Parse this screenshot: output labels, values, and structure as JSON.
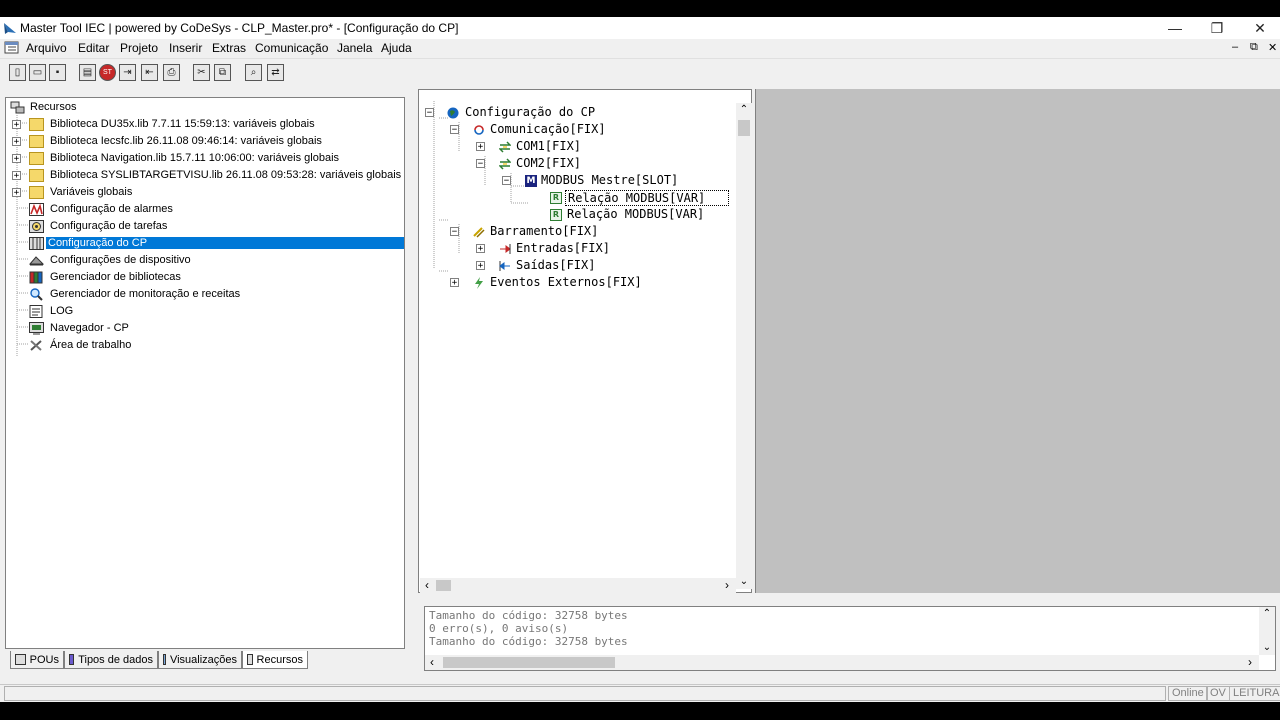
{
  "window": {
    "title": "Master Tool IEC | powered by CoDeSys - CLP_Master.pro* - [Configuração do CP]",
    "minimize_glyph": "—",
    "restore_glyph": "❐",
    "close_glyph": "✕",
    "child_minimize_glyph": "–",
    "child_restore_glyph": "⧉",
    "child_close_glyph": "✕"
  },
  "menu": [
    "Arquivo",
    "Editar",
    "Projeto",
    "Inserir",
    "Extras",
    "Comunicação",
    "Janela",
    "Ajuda"
  ],
  "toolbar": {
    "icons": [
      "new-icon",
      "open-icon",
      "save-icon",
      "build-icon",
      "stop-icon",
      "login-icon",
      "logout-icon",
      "print-icon",
      "cut-icon",
      "copy-icon",
      "find-icon",
      "replace-icon"
    ],
    "glyphs": [
      "▯",
      "▭",
      "▪",
      "▤",
      "ST",
      "⇥",
      "⇤",
      "⎙",
      "✂",
      "⧉",
      "⌕",
      "⇄"
    ]
  },
  "resources_tree": {
    "root": "Recursos",
    "items": [
      {
        "label": "Biblioteca DU35x.lib 7.7.11 15:59:13: variáveis globais",
        "expander": "+",
        "icon": "folder-icon"
      },
      {
        "label": "Biblioteca Iecsfc.lib 26.11.08 09:46:14: variáveis globais",
        "expander": "+",
        "icon": "folder-icon"
      },
      {
        "label": "Biblioteca Navigation.lib 15.7.11 10:06:00: variáveis globais",
        "expander": "+",
        "icon": "folder-icon"
      },
      {
        "label": "Biblioteca SYSLIBTARGETVISU.lib 26.11.08 09:53:28: variáveis globais",
        "expander": "+",
        "icon": "folder-icon"
      },
      {
        "label": "Variáveis globais",
        "expander": "+",
        "icon": "folder-icon"
      },
      {
        "label": "Configuração de alarmes",
        "expander": "",
        "icon": "alarm-icon"
      },
      {
        "label": "Configuração de tarefas",
        "expander": "",
        "icon": "task-icon"
      },
      {
        "label": "Configuração do CP",
        "expander": "",
        "icon": "plc-config-icon",
        "selected": true
      },
      {
        "label": "Configurações de dispositivo",
        "expander": "",
        "icon": "device-icon"
      },
      {
        "label": "Gerenciador de bibliotecas",
        "expander": "",
        "icon": "library-icon"
      },
      {
        "label": "Gerenciador de monitoração e receitas",
        "expander": "",
        "icon": "magnifier-icon"
      },
      {
        "label": "LOG",
        "expander": "",
        "icon": "log-icon"
      },
      {
        "label": "Navegador - CP",
        "expander": "",
        "icon": "navigator-icon"
      },
      {
        "label": "Área de trabalho",
        "expander": "",
        "icon": "tools-icon"
      }
    ]
  },
  "bottom_tabs": [
    {
      "label": "POUs",
      "active": false
    },
    {
      "label": "Tipos de dados",
      "active": false
    },
    {
      "label": "Visualizações",
      "active": false
    },
    {
      "label": "Recursos",
      "active": true
    }
  ],
  "config_tree": [
    {
      "label": "Configuração do CP",
      "expander": "−",
      "icon": "globe-icon"
    },
    {
      "label": "Comunicação[FIX]",
      "expander": "−",
      "icon": "communication-icon"
    },
    {
      "label": "COM1[FIX]",
      "expander": "+",
      "icon": "serial-port-icon"
    },
    {
      "label": "COM2[FIX]",
      "expander": "−",
      "icon": "serial-port-icon"
    },
    {
      "label": "MODBUS Mestre[SLOT]",
      "expander": "−",
      "icon": "modbus-master-icon",
      "glyph": "M"
    },
    {
      "label": "Relação MODBUS[VAR]",
      "expander": "",
      "icon": "modbus-relation-icon",
      "glyph": "R",
      "focused": true
    },
    {
      "label": "Relação MODBUS[VAR]",
      "expander": "",
      "icon": "modbus-relation-icon",
      "glyph": "R"
    },
    {
      "label": "Barramento[FIX]",
      "expander": "−",
      "icon": "bus-icon"
    },
    {
      "label": "Entradas[FIX]",
      "expander": "+",
      "icon": "inputs-icon"
    },
    {
      "label": "Saídas[FIX]",
      "expander": "+",
      "icon": "outputs-icon"
    },
    {
      "label": "Eventos Externos[FIX]",
      "expander": "+",
      "icon": "lightning-icon"
    }
  ],
  "messages": [
    "Tamanho do código: 32758 bytes",
    "0 erro(s), 0 aviso(s)",
    "Tamanho do código: 32758 bytes"
  ],
  "scroll_glyphs": {
    "up": "⌃",
    "down": "⌄",
    "left": "‹",
    "right": "›"
  },
  "status": [
    "Online",
    "OV",
    "LEITURA"
  ]
}
